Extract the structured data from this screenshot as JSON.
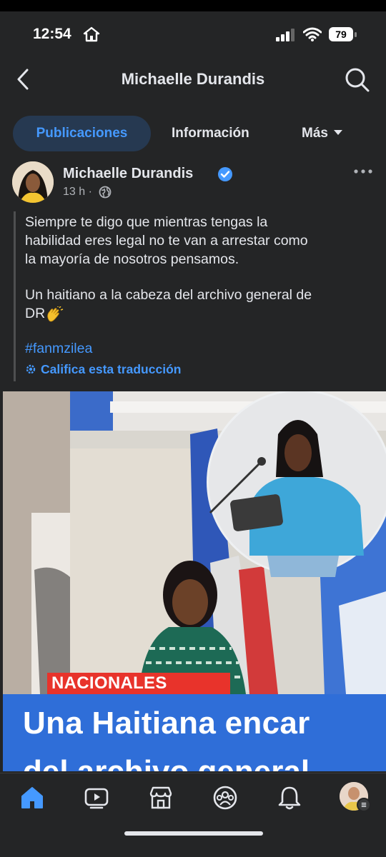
{
  "status_bar": {
    "time": "12:54",
    "battery": "79"
  },
  "header": {
    "title": "Michaelle Durandis"
  },
  "tabs": [
    {
      "label": "Publicaciones",
      "active": true
    },
    {
      "label": "Información",
      "active": false
    },
    {
      "label": "Más",
      "active": false
    }
  ],
  "post": {
    "author": "Michaelle Durandis",
    "verified": true,
    "time": "13 h ·",
    "text_lines": [
      "Siempre te digo que mientras tengas la",
      "habilidad eres legal no te van a arrestar como",
      "la mayoría de nosotros pensamos."
    ],
    "text2_lines": [
      "Un haitiano a la cabeza del archivo general de",
      "DR"
    ],
    "hashtag": "#fanmzilea",
    "rate_translation": "Califica esta traducción"
  },
  "media": {
    "tag": "NACIONALES",
    "headline_line1": "Una Haitiana encar",
    "headline_line2": "del archivo general"
  },
  "bottom_nav": {
    "items": [
      "home-icon",
      "video-icon",
      "marketplace-icon",
      "groups-icon",
      "notifications-icon",
      "profile-menu"
    ]
  },
  "colors": {
    "accent": "#4599ff",
    "background": "#242526",
    "text": "#e4e6eb"
  }
}
